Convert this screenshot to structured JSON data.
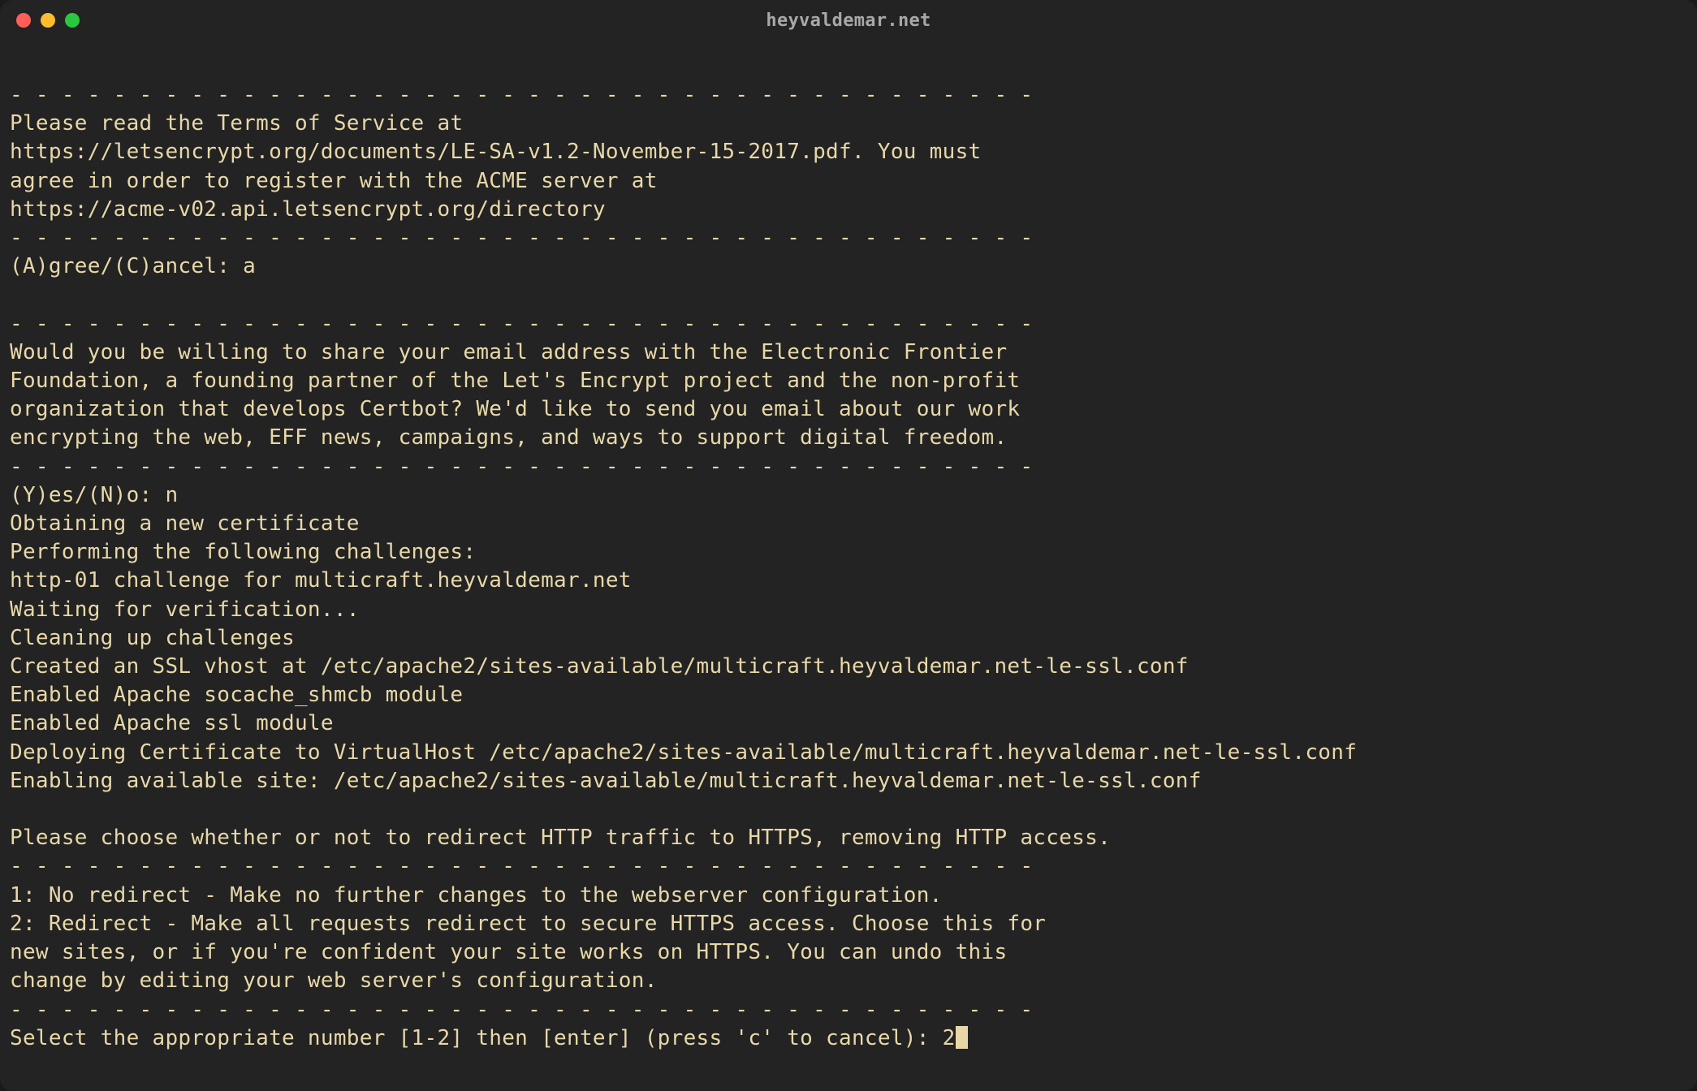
{
  "window": {
    "title": "heyvaldemar.net"
  },
  "terminal": {
    "lines": [
      "- - - - - - - - - - - - - - - - - - - - - - - - - - - - - - - - - - - - - - - -",
      "Please read the Terms of Service at",
      "https://letsencrypt.org/documents/LE-SA-v1.2-November-15-2017.pdf. You must",
      "agree in order to register with the ACME server at",
      "https://acme-v02.api.letsencrypt.org/directory",
      "- - - - - - - - - - - - - - - - - - - - - - - - - - - - - - - - - - - - - - - -",
      "(A)gree/(C)ancel: a",
      "",
      "- - - - - - - - - - - - - - - - - - - - - - - - - - - - - - - - - - - - - - - -",
      "Would you be willing to share your email address with the Electronic Frontier",
      "Foundation, a founding partner of the Let's Encrypt project and the non-profit",
      "organization that develops Certbot? We'd like to send you email about our work",
      "encrypting the web, EFF news, campaigns, and ways to support digital freedom.",
      "- - - - - - - - - - - - - - - - - - - - - - - - - - - - - - - - - - - - - - - -",
      "(Y)es/(N)o: n",
      "Obtaining a new certificate",
      "Performing the following challenges:",
      "http-01 challenge for multicraft.heyvaldemar.net",
      "Waiting for verification...",
      "Cleaning up challenges",
      "Created an SSL vhost at /etc/apache2/sites-available/multicraft.heyvaldemar.net-le-ssl.conf",
      "Enabled Apache socache_shmcb module",
      "Enabled Apache ssl module",
      "Deploying Certificate to VirtualHost /etc/apache2/sites-available/multicraft.heyvaldemar.net-le-ssl.conf",
      "Enabling available site: /etc/apache2/sites-available/multicraft.heyvaldemar.net-le-ssl.conf",
      "",
      "Please choose whether or not to redirect HTTP traffic to HTTPS, removing HTTP access.",
      "- - - - - - - - - - - - - - - - - - - - - - - - - - - - - - - - - - - - - - - -",
      "1: No redirect - Make no further changes to the webserver configuration.",
      "2: Redirect - Make all requests redirect to secure HTTPS access. Choose this for",
      "new sites, or if you're confident your site works on HTTPS. You can undo this",
      "change by editing your web server's configuration.",
      "- - - - - - - - - - - - - - - - - - - - - - - - - - - - - - - - - - - - - - - -"
    ],
    "prompt_line": "Select the appropriate number [1-2] then [enter] (press 'c' to cancel): 2"
  }
}
